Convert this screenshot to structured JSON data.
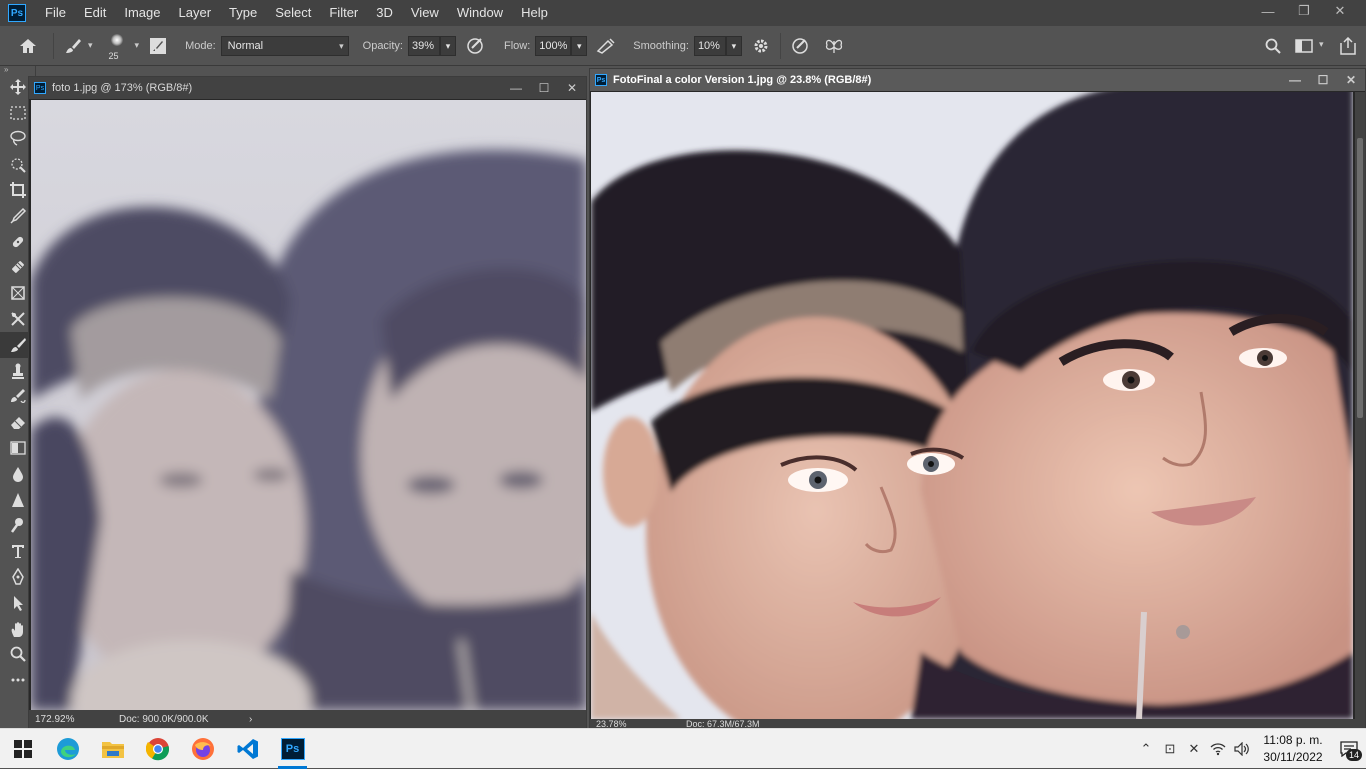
{
  "app": {
    "logo_text": "Ps"
  },
  "menu": [
    "File",
    "Edit",
    "Image",
    "Layer",
    "Type",
    "Select",
    "Filter",
    "3D",
    "View",
    "Window",
    "Help"
  ],
  "window_controls": {
    "minimize": "—",
    "restore": "❐",
    "close": "✕"
  },
  "options": {
    "brush_size": "25",
    "mode_label": "Mode:",
    "mode_value": "Normal",
    "opacity_label": "Opacity:",
    "opacity_value": "39%",
    "flow_label": "Flow:",
    "flow_value": "100%",
    "smoothing_label": "Smoothing:",
    "smoothing_value": "10%"
  },
  "tools": [
    "move-tool",
    "marquee-tool",
    "lasso-tool",
    "quick-select-tool",
    "crop-tool",
    "eyedropper-tool",
    "healing-brush-tool",
    "bandage-tool",
    "frame-tool",
    "patch-tool",
    "brush-tool",
    "clone-stamp-tool",
    "history-brush-tool",
    "eraser-tool",
    "gradient-tool",
    "blur-tool",
    "sharpen-tool",
    "dodge-tool",
    "type-tool",
    "pen-tool",
    "path-select-tool",
    "hand-tool",
    "zoom-tool",
    "more-tools"
  ],
  "doc1": {
    "title": "foto 1.jpg @ 173% (RGB/8#)",
    "zoom": "172.92%",
    "doc_size": "Doc: 900.0K/900.0K"
  },
  "doc2": {
    "title": "FotoFinal a color Version 1.jpg @ 23.8% (RGB/8#)",
    "zoom": "23.78%",
    "doc_size": "Doc: 67.3M/67.3M"
  },
  "taskbar": {
    "apps": [
      "windows-start",
      "edge",
      "file-explorer",
      "chrome",
      "firefox",
      "vscode",
      "photoshop"
    ],
    "time": "11:08 p. m.",
    "date": "30/11/2022",
    "notifications": "14"
  }
}
